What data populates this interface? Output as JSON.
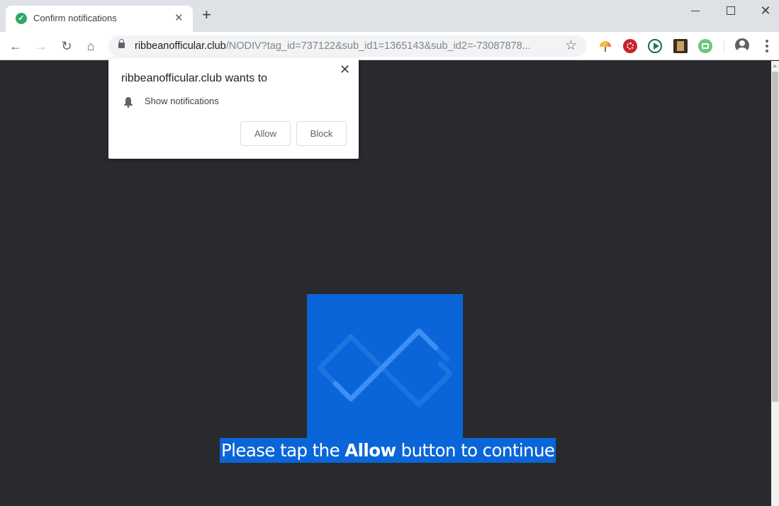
{
  "browser": {
    "tab": {
      "title": "Confirm notifications",
      "favicon": "check-circle-icon",
      "favicon_color": "#2fa866"
    },
    "new_tab_label": "+",
    "window_controls": {
      "close": "✕"
    },
    "nav": {
      "back": "←",
      "forward": "→",
      "reload": "↻",
      "home": "⌂"
    },
    "address": {
      "host": "ribbeanofficular.club",
      "path": "/NODIV?tag_id=737122&sub_id1=1365143&sub_id2=-73087878..."
    },
    "bookmark_star": "☆",
    "extensions": [
      "umbrella-extension",
      "film-reel-extension",
      "play-extension",
      "film-strip-extension",
      "tv-extension"
    ]
  },
  "permission_popup": {
    "title": "ribbeanofficular.club wants to",
    "permission": "Show notifications",
    "close": "✕",
    "allow_label": "Allow",
    "block_label": "Block"
  },
  "page": {
    "background": "#292a2e",
    "accent": "#0a66d8",
    "caption_before": "Please tap the ",
    "caption_bold": "Allow",
    "caption_after": " button to continue"
  }
}
